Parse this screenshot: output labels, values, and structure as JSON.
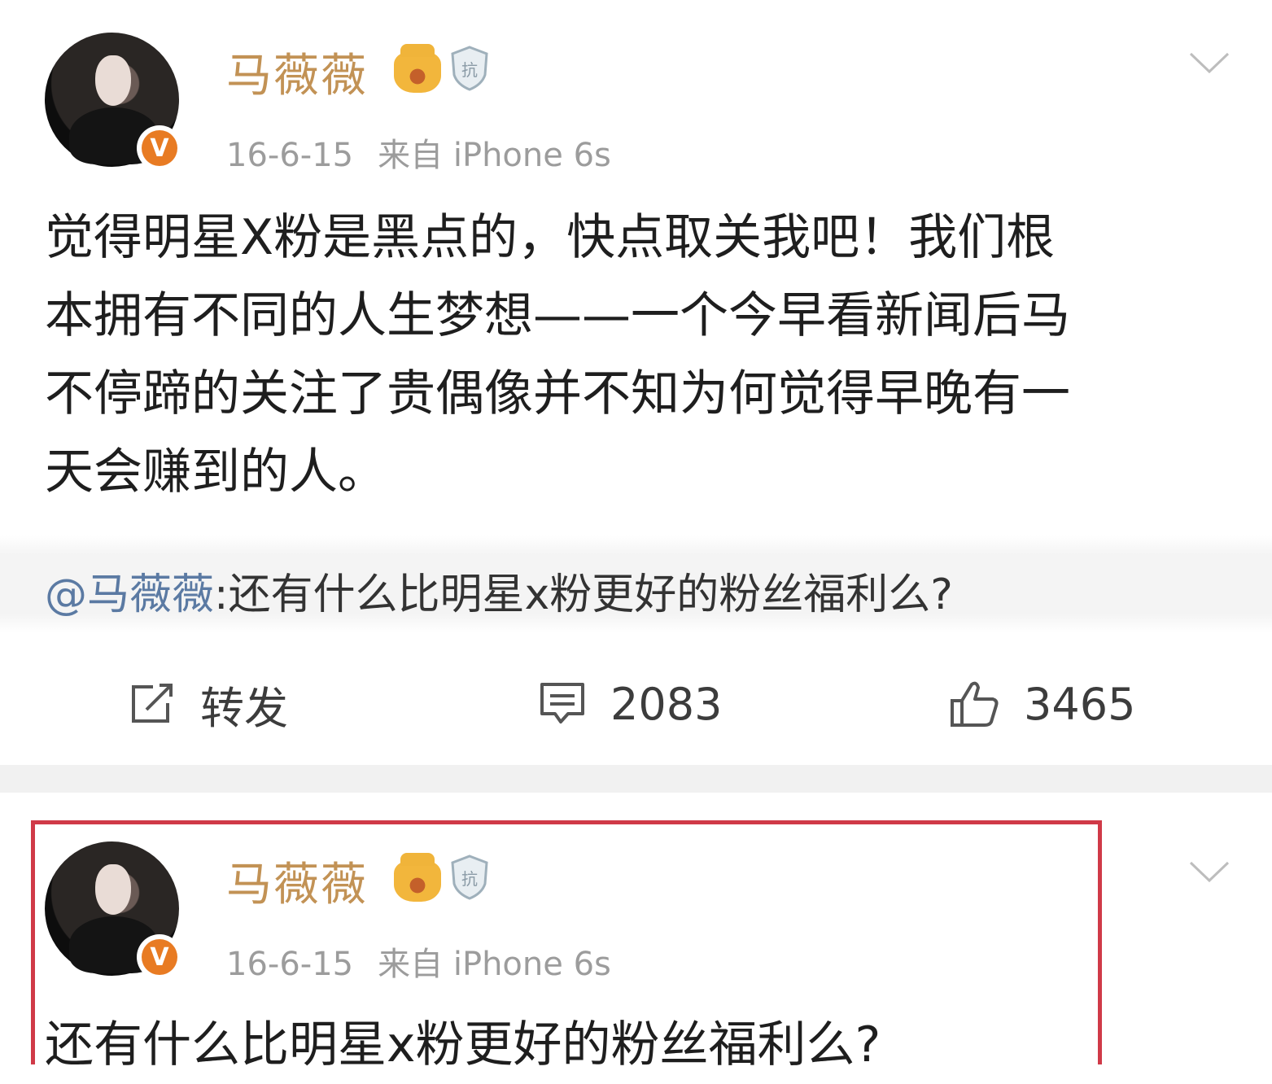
{
  "posts": [
    {
      "username": "马薇薇",
      "date": "16-6-15",
      "source": "来自 iPhone 6s",
      "verified_badge": "V",
      "shield_text": "抗",
      "content_lines": [
        "觉得明星X粉是黑点的，快点取关我吧！我们根",
        "本拥有不同的人生梦想——一个今早看新闻后马",
        "不停蹄的关注了贵偶像并不知为何觉得早晚有一",
        "天会赚到的人。"
      ],
      "quote": {
        "at": "@马薇薇",
        "text": ":还有什么比明星x粉更好的粉丝福利么?"
      },
      "actions": {
        "repost": "转发",
        "comments": "2083",
        "likes": "3465"
      }
    },
    {
      "username": "马薇薇",
      "date": "16-6-15",
      "source": "来自 iPhone 6s",
      "verified_badge": "V",
      "shield_text": "抗",
      "content": "还有什么比明星x粉更好的粉丝福利么?"
    }
  ],
  "icons": {
    "crown": "crown-icon",
    "shield": "shield-icon",
    "chevron": "chevron-down-icon",
    "repost": "repost-icon",
    "comment": "comment-icon",
    "like": "like-icon",
    "verified": "verified-icon"
  },
  "colors": {
    "username": "#c29255",
    "meta": "#9c9c9c",
    "at_link": "#5b7aa3",
    "verified": "#e87b23",
    "highlight_border": "#d03a48"
  }
}
